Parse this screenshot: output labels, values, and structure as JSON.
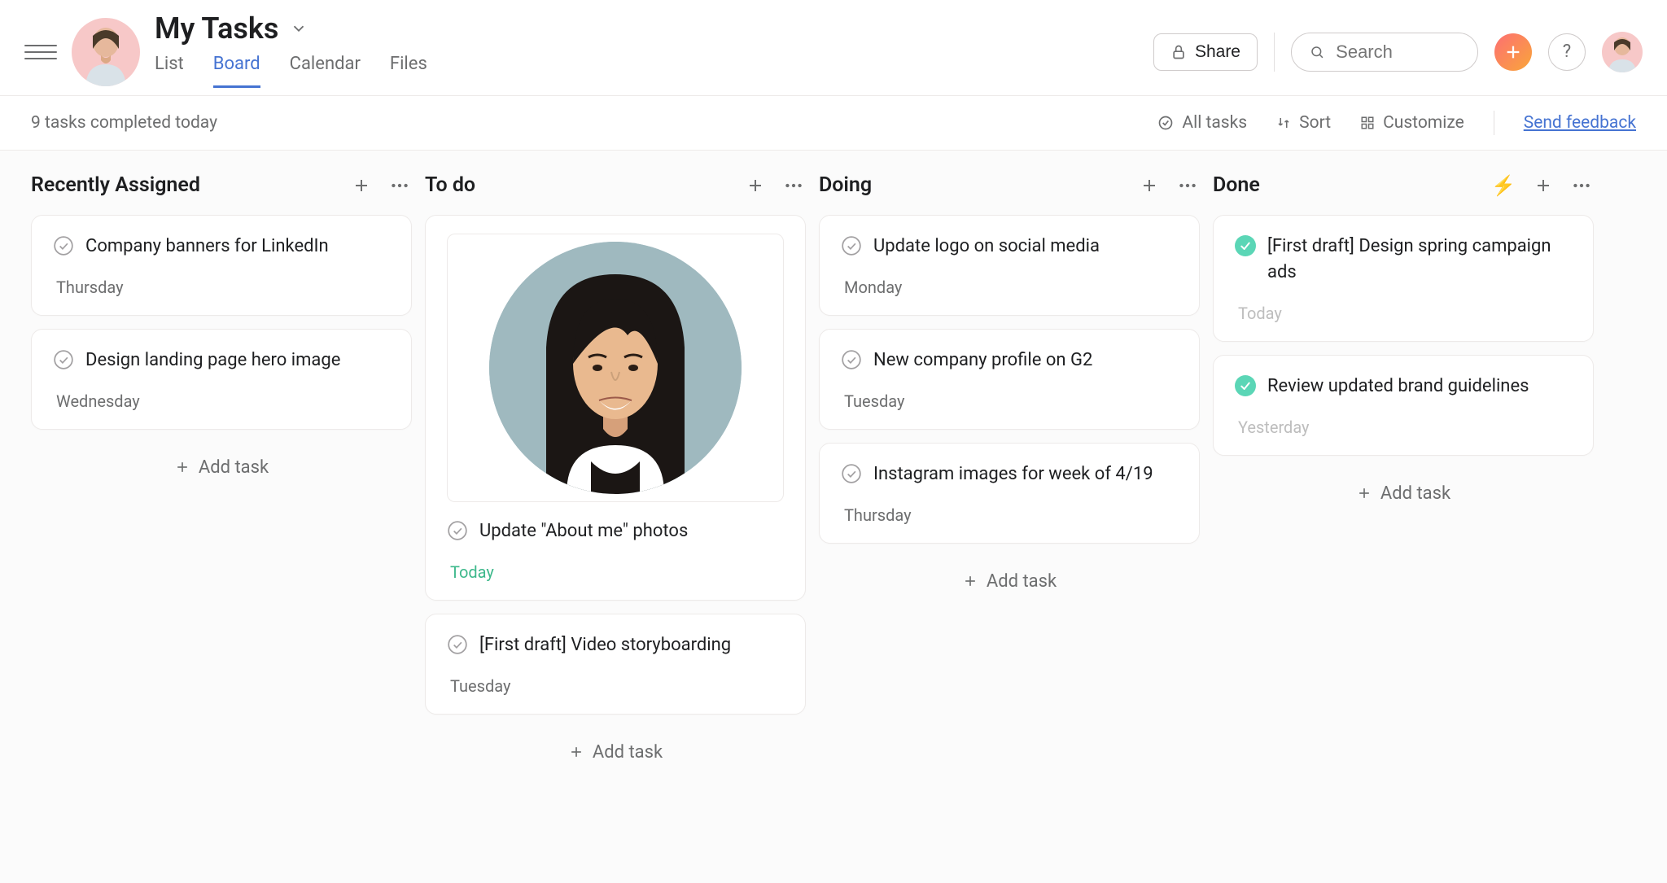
{
  "header": {
    "title": "My Tasks",
    "tabs": [
      "List",
      "Board",
      "Calendar",
      "Files"
    ],
    "active_tab": 1,
    "share_label": "Share",
    "search_placeholder": "Search"
  },
  "toolbar": {
    "status": "9 tasks completed today",
    "filter_label": "All tasks",
    "sort_label": "Sort",
    "customize_label": "Customize",
    "feedback_label": "Send feedback"
  },
  "add_task_label": "Add task",
  "columns": [
    {
      "title": "Recently Assigned",
      "has_bolt": false,
      "cards": [
        {
          "title": "Company banners for LinkedIn",
          "date": "Thursday",
          "date_style": "normal",
          "completed": false,
          "has_image": false
        },
        {
          "title": "Design landing page hero image",
          "date": "Wednesday",
          "date_style": "normal",
          "completed": false,
          "has_image": false
        }
      ]
    },
    {
      "title": "To do",
      "has_bolt": false,
      "cards": [
        {
          "title": "Update \"About me\" photos",
          "date": "Today",
          "date_style": "today",
          "completed": false,
          "has_image": true
        },
        {
          "title": "[First draft] Video storyboarding",
          "date": "Tuesday",
          "date_style": "normal",
          "completed": false,
          "has_image": false
        }
      ]
    },
    {
      "title": "Doing",
      "has_bolt": false,
      "cards": [
        {
          "title": "Update logo on social media",
          "date": "Monday",
          "date_style": "normal",
          "completed": false,
          "has_image": false
        },
        {
          "title": "New company profile on G2",
          "date": "Tuesday",
          "date_style": "normal",
          "completed": false,
          "has_image": false
        },
        {
          "title": "Instagram images for week of 4/19",
          "date": "Thursday",
          "date_style": "normal",
          "completed": false,
          "has_image": false
        }
      ]
    },
    {
      "title": "Done",
      "has_bolt": true,
      "cards": [
        {
          "title": "[First draft] Design spring campaign ads",
          "date": "Today",
          "date_style": "done",
          "completed": true,
          "has_image": false
        },
        {
          "title": "Review updated brand guidelines",
          "date": "Yesterday",
          "date_style": "done",
          "completed": true,
          "has_image": false
        }
      ]
    }
  ]
}
